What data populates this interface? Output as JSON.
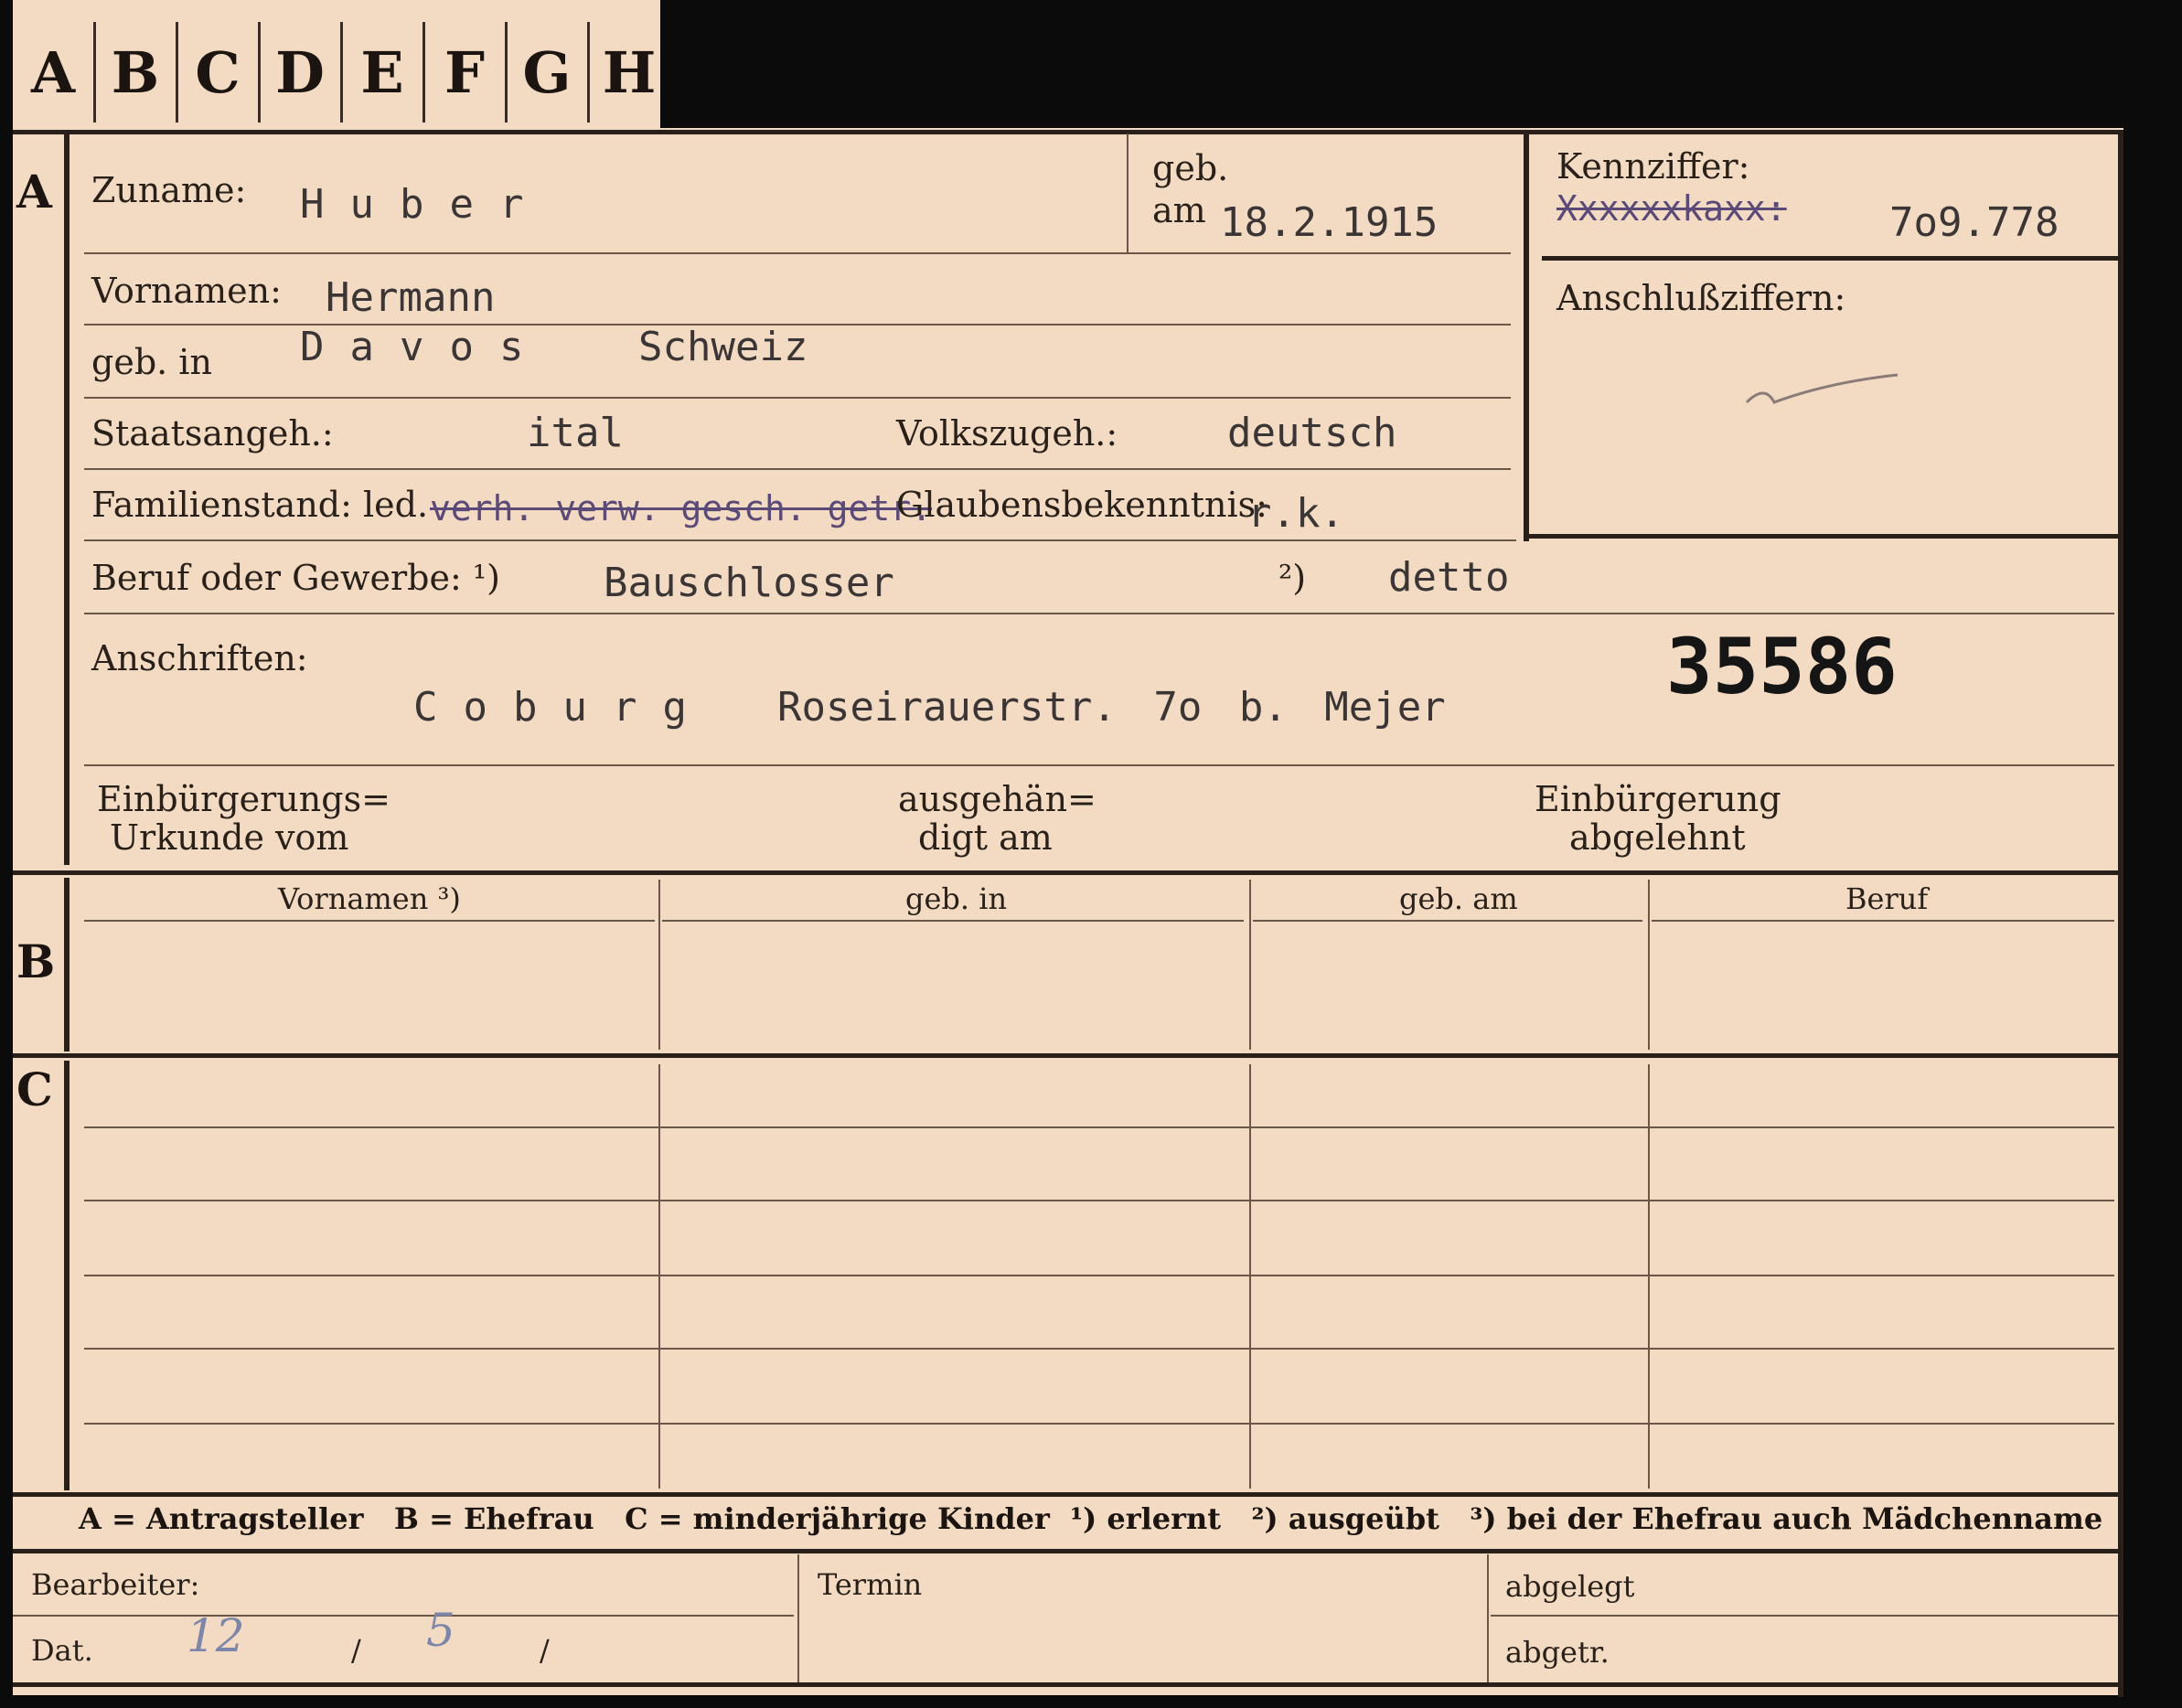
{
  "tabs": [
    "A",
    "B",
    "C",
    "D",
    "E",
    "F",
    "G",
    "H"
  ],
  "sections": {
    "a": "A",
    "b": "B",
    "c": "C"
  },
  "labels": {
    "zuname": "Zuname:",
    "geb": "geb.",
    "am": "am",
    "kennziffer": "Kennziffer:",
    "vornamen": "Vornamen:",
    "anschlussziffern": "Anschlußziffern:",
    "geb_in": "geb. in",
    "staatsangeh": "Staatsangeh.:",
    "volkszugeh": "Volkszugeh.:",
    "familienstand": "Familienstand: led.",
    "glaubensbekenntnis": "Glaubensbekenntnis:",
    "beruf": "Beruf oder Gewerbe: ¹)",
    "beruf_note2": "²)",
    "anschriften": "Anschriften:",
    "einbuergerung_1": "Einbürgerungs=",
    "einbuergerung_2": "Urkunde vom",
    "ausgehaendigt_1": "ausgehän=",
    "ausgehaendigt_2": "digt am",
    "abgelehnt_1": "Einbürgerung",
    "abgelehnt_2": "abgelehnt"
  },
  "values": {
    "zuname": "Huber",
    "geb_am": "18.2.1915",
    "kennziffer_struck": "Xxxxxxkaxx:",
    "kennziffer": "7o9.778",
    "vornamen": "Hermann",
    "geb_in": "Davos",
    "geb_land": "Schweiz",
    "staatsangeh": "ital",
    "volkszugeh": "deutsch",
    "familienstand_struck": "verh. verw. gesch. getr.",
    "glaubensbekenntnis": "r.k.",
    "beruf_erlernt": "Bauschlosser",
    "beruf_ausgeuebt": "detto",
    "anschrift_ort": "Coburg",
    "anschrift_strasse": "Roseirauerstr. 7o b. Mejer",
    "card_number": "35586"
  },
  "table": {
    "headers": [
      "Vornamen ³)",
      "geb. in",
      "geb. am",
      "Beruf"
    ]
  },
  "legend": "A = Antragsteller   B = Ehefrau   C = minderjährige Kinder  ¹) erlernt   ²) ausgeübt   ³) bei der Ehefrau auch Mädchenname",
  "footer": {
    "bearbeiter": "Bearbeiter:",
    "dat": "Dat.",
    "dat_day": "12",
    "dat_sep1": "/",
    "dat_month": "5",
    "dat_sep2": "/",
    "termin": "Termin",
    "abgelegt": "abgelegt",
    "abgetr": "abgetr."
  }
}
